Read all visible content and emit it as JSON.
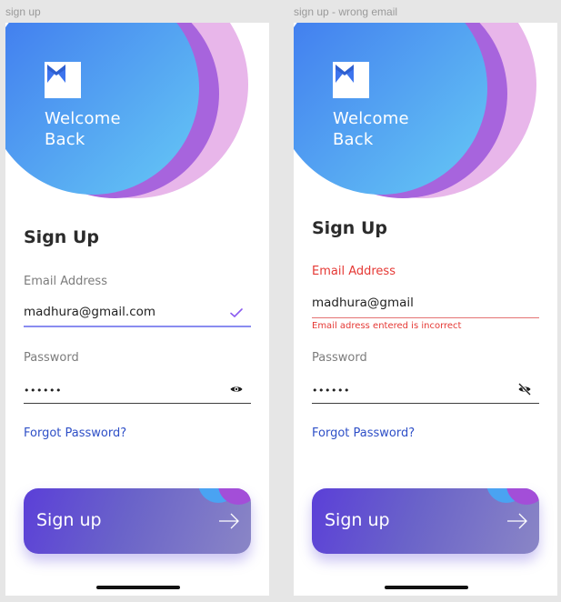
{
  "colors": {
    "accent": "#5b3fd8",
    "link": "#2e4fc7",
    "error": "#e53935",
    "check": "#8a5cf0"
  },
  "frames": [
    {
      "frame_label": "sign up",
      "welcome_line1": "Welcome",
      "welcome_line2": "Back",
      "title": "Sign Up",
      "email_label": "Email Address",
      "email_value": "madhura@gmail.com",
      "email_icon": "check-icon",
      "error_text": "",
      "password_label": "Password",
      "password_value": "••••••",
      "password_icon": "eye-icon",
      "forgot": "Forgot Password?",
      "cta": "Sign up"
    },
    {
      "frame_label": "sign up - wrong email",
      "welcome_line1": "Welcome",
      "welcome_line2": "Back",
      "title": "Sign Up",
      "email_label": "Email Address",
      "email_value": "madhura@gmail",
      "email_icon": "",
      "error_text": "Email adress entered is incorrect",
      "password_label": "Password",
      "password_value": "••••••",
      "password_icon": "eye-off-icon",
      "forgot": "Forgot Password?",
      "cta": "Sign up"
    }
  ]
}
